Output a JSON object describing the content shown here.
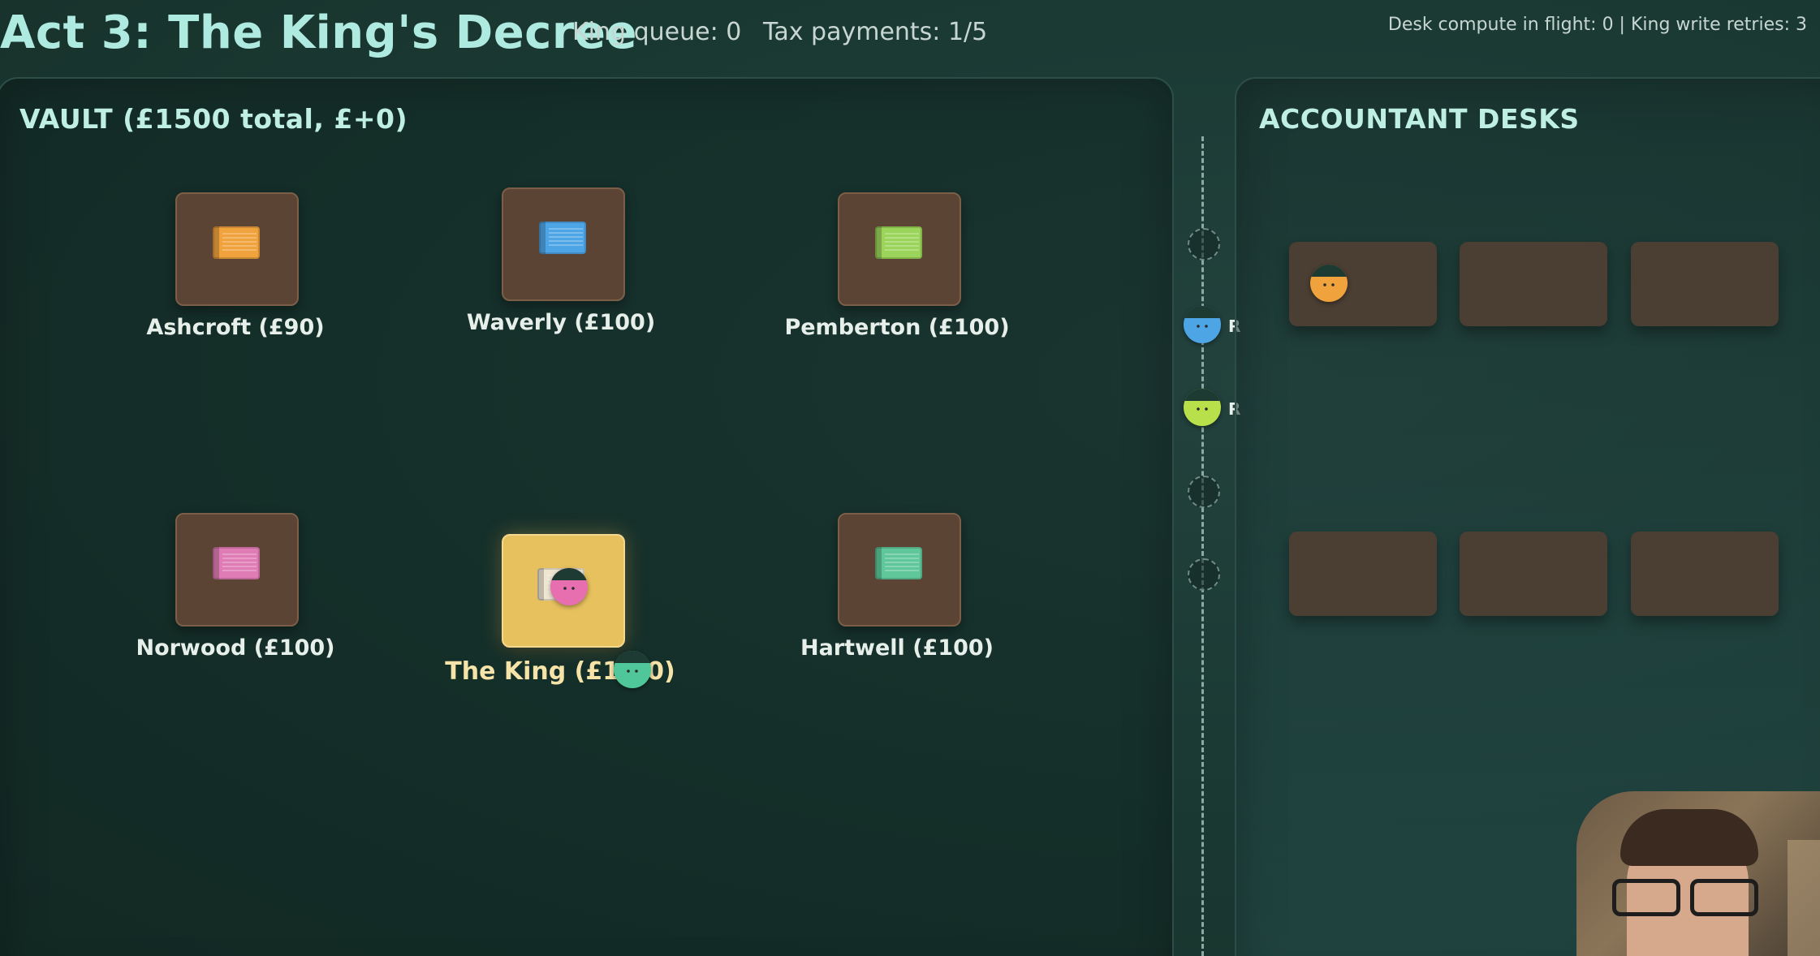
{
  "header": {
    "title": "Act 3: The King's Decree",
    "king_queue": "King queue: 0",
    "tax_payments": "Tax payments: 1/5",
    "desk_compute": "Desk compute in flight: 0 | King write retries: 3"
  },
  "vault": {
    "title": "VAULT (£1500 total, £+0)",
    "accounts": [
      {
        "label": "Ashcroft (£90)",
        "ledger_color": "#f0a23c"
      },
      {
        "label": "Waverly (£100)",
        "ledger_color": "#4ea5e6"
      },
      {
        "label": "Pemberton (£100)",
        "ledger_color": "#9bd45a"
      },
      {
        "label": "Norwood (£100)",
        "ledger_color": "#e07cb5"
      },
      {
        "label": "The King (£1​​0)",
        "ledger_color": "#e7c15e"
      },
      {
        "label": "Hartwell (£100)",
        "ledger_color": "#5fc79a"
      }
    ]
  },
  "king_label": "The King (£1",
  "king_label_tail": "0)",
  "desks": {
    "title": "ACCOUNTANT DESKS",
    "count": 6
  },
  "channel": {
    "retry_marker": "R"
  },
  "colors": {
    "worker_blue": "#4ea5e6",
    "worker_green": "#b7e04a",
    "worker_orange": "#f0a23c",
    "worker_pink": "#e76fb0",
    "worker_teal": "#4fc79a"
  }
}
